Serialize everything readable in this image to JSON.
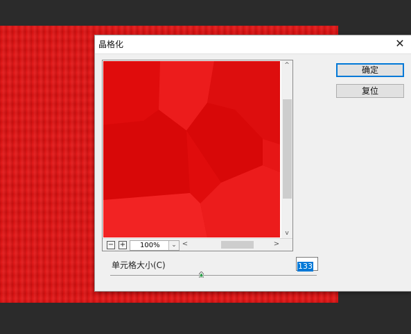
{
  "dialog": {
    "title": "晶格化",
    "close_glyph": "✕",
    "ok_label": "确定",
    "reset_label": "复位"
  },
  "preview": {
    "zoom": "100%",
    "zoom_out_glyph": "−",
    "zoom_in_glyph": "+",
    "dropdown_glyph": "⌄",
    "scroll_up_glyph": "^",
    "scroll_down_glyph": "v",
    "scroll_left_glyph": "<",
    "scroll_right_glyph": ">"
  },
  "params": {
    "cell_size_label": "单元格大小(C)",
    "cell_size_value": "133",
    "cell_size_fraction": 0.44
  },
  "colors": {
    "canvas": "#e11212",
    "accent": "#0078d7",
    "cells": [
      "#e00c0c",
      "#ec1c1c",
      "#d80808",
      "#f22323",
      "#dd0e0e",
      "#e61616"
    ]
  }
}
